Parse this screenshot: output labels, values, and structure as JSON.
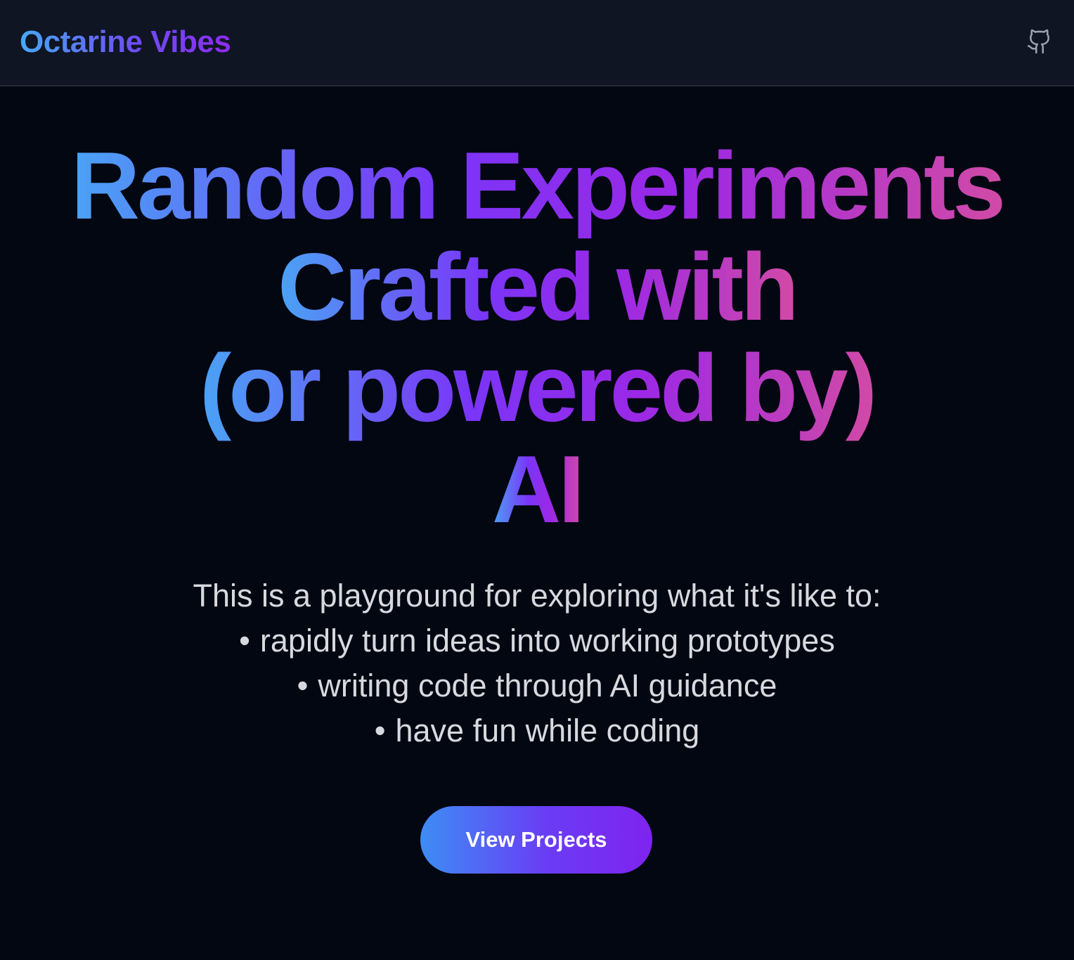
{
  "header": {
    "brand": "Octarine Vibes",
    "github_icon": "github-icon",
    "icon_color": "#9ca3af"
  },
  "hero": {
    "title_lines": [
      "Random Experiments",
      "Crafted with",
      "(or powered by)",
      "AI"
    ],
    "intro": "This is a playground for exploring what it's like to:",
    "bullets": [
      "rapidly turn ideas into working prototypes",
      "writing code through AI guidance",
      "have fun while coding"
    ],
    "bullet_symbol": "•",
    "cta_label": "View Projects"
  },
  "colors": {
    "background": "#030712",
    "header_background": "#0f1523",
    "gradient_start": "#4aa3f5",
    "gradient_mid": "#7a35f7",
    "gradient_end": "#d14aa6",
    "body_text": "#d7d9de"
  }
}
